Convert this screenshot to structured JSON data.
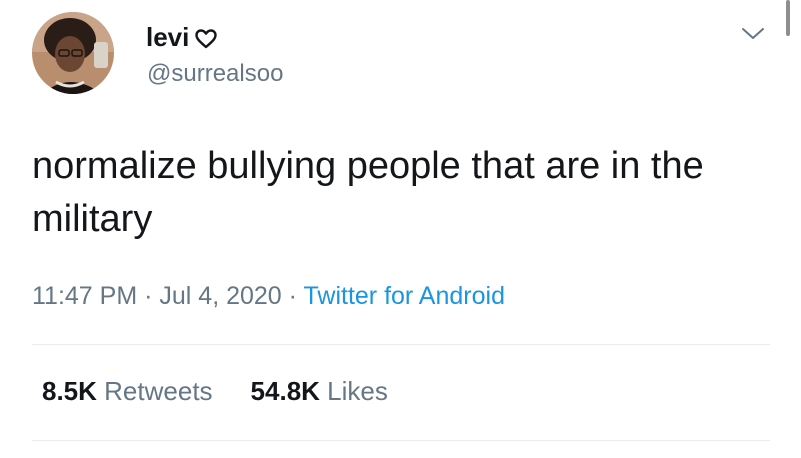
{
  "user": {
    "display_name": "levi",
    "name_badge_icon": "heart-outline-icon",
    "handle": "@surrealsoo"
  },
  "tweet": {
    "text": "normalize bullying people that are in the military",
    "time": "11:47 PM",
    "separator": "·",
    "date": "Jul 4, 2020",
    "source": "Twitter for Android"
  },
  "stats": {
    "retweets_count": "8.5K",
    "retweets_label": "Retweets",
    "likes_count": "54.8K",
    "likes_label": "Likes"
  },
  "icons": {
    "more_menu": "chevron-down-icon"
  },
  "colors": {
    "text_primary": "#14171a",
    "text_secondary": "#657786",
    "link": "#1b95e0",
    "divider": "#e6ecf0"
  }
}
